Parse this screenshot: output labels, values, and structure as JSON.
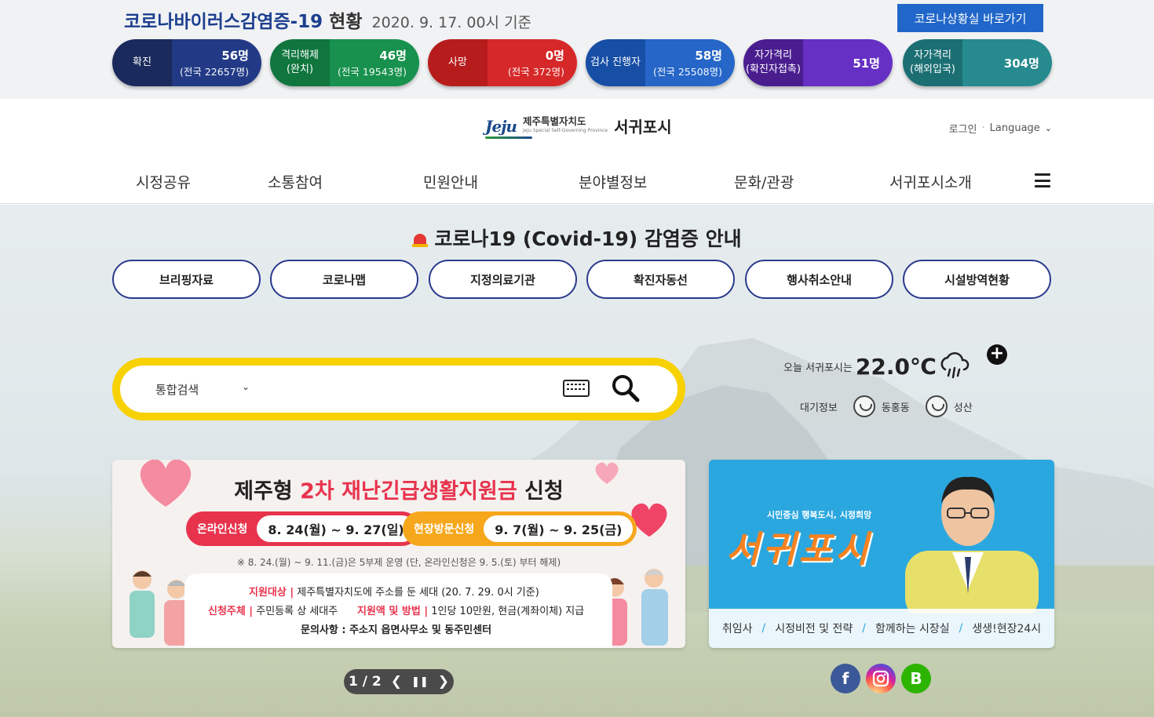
{
  "covid": {
    "title_main": "코로나바이러스감염증-19",
    "title_sub": "현황",
    "date": "2020. 9. 17. 00시 기준",
    "link_label": "코로나상황실 바로가기",
    "stats": [
      {
        "label": "확진",
        "value": "56명",
        "national": "(전국 22657명)"
      },
      {
        "label": "격리해제\n(완치)",
        "value": "46명",
        "national": "(전국 19543명)"
      },
      {
        "label": "사망",
        "value": "0명",
        "national": "(전국 372명)"
      },
      {
        "label": "검사 진행자",
        "value": "58명",
        "national": "(전국 25508명)"
      },
      {
        "label": "자가격리\n(확진자접촉)",
        "value": "51명",
        "national": ""
      },
      {
        "label": "자가격리\n(해외입국)",
        "value": "304명",
        "national": ""
      }
    ]
  },
  "header": {
    "logo_mark": "Jeju",
    "logo_province_ko": "제주특별자치도",
    "logo_province_en": "Jeju Special Self-Governing Province",
    "logo_city": "서귀포시",
    "login": "로그인",
    "language": "Language",
    "nav": [
      "시정공유",
      "소통참여",
      "민원안내",
      "분야별정보",
      "문화/관광",
      "서귀포시소개"
    ]
  },
  "notice": {
    "title": "코로나19 (Covid-19) 감염증 안내",
    "buttons": [
      "브리핑자료",
      "코로나맵",
      "지정의료기관",
      "확진자동선",
      "행사취소안내",
      "시설방역현황"
    ]
  },
  "search": {
    "scope": "통합검색"
  },
  "weather": {
    "today_label": "오늘 서귀포시는",
    "temperature": "22.0℃",
    "air_label": "대기정보",
    "stations": [
      "동홍동",
      "성산"
    ]
  },
  "banner": {
    "title_pre": "제주형 ",
    "title_hl": "2차 재난긴급생활지원금",
    "title_post": " 신청",
    "online_label": "온라인신청",
    "online_dates": "8. 24(월) ~ 9. 27(일)",
    "visit_label": "현장방문신청",
    "visit_dates": "9. 7(월) ~ 9. 25(금)",
    "note": "※ 8. 24.(월) ~ 9. 11.(금)은 5부제 운영 (단, 온라인신청은 9. 5.(토) 부터 해제)",
    "target_label": "지원대상 |",
    "target_text": " 제주특별자치도에 주소를 둔 세대 (20. 7. 29. 0시 기준)",
    "applicant_label": "신청주체 |",
    "applicant_text": " 주민등록 상 세대주",
    "amount_label": "지원액 및 방법 |",
    "amount_text": " 1인당 10만원, 현금(계좌이체) 지급",
    "contact": "문의사항 : 주소지 읍면사무소 및 동주민센터"
  },
  "mayor": {
    "slogan": "시민중심 행복도시, 시정희망",
    "city_big": "서귀포시",
    "links": [
      "취임사",
      "시정비전 및 전략",
      "함께하는 시장실",
      "생생!현장24시"
    ]
  },
  "pager": {
    "current": "1",
    "sep": "/",
    "total": "2"
  },
  "social": {
    "facebook": "f",
    "blog": "B"
  },
  "colors": {
    "navy": "#223a86",
    "yellow": "#f7d100",
    "banner_red": "#e8334d",
    "banner_orange": "#f6a71b",
    "mayor_blue": "#2ba7df"
  }
}
